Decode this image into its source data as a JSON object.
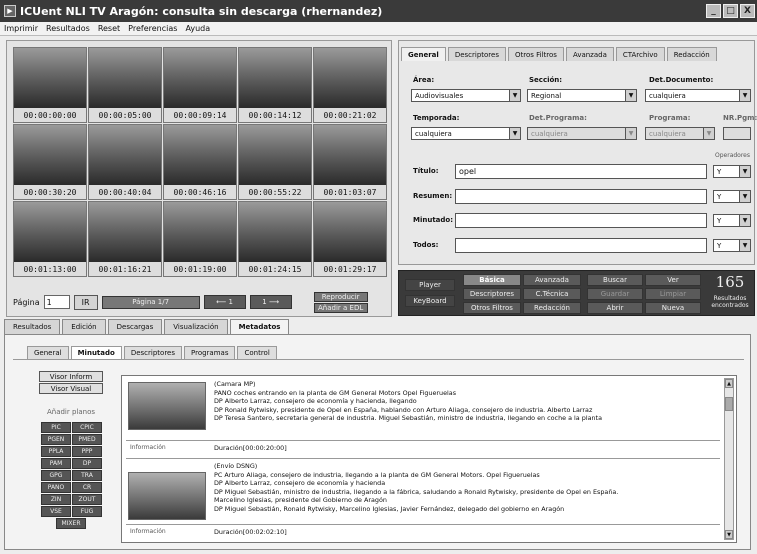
{
  "window": {
    "title": "ICUent NLI TV Aragón: consulta sin descarga (rhernandez)",
    "minimize": "_",
    "maximize": "□",
    "close": "X"
  },
  "menu": [
    "Imprimir",
    "Resultados",
    "Reset",
    "Preferencias",
    "Ayuda"
  ],
  "thumbnails": [
    "00:00:00:00",
    "00:00:05:00",
    "00:00:09:14",
    "00:00:14:12",
    "00:00:21:02",
    "00:00:30:20",
    "00:00:40:04",
    "00:00:46:16",
    "00:00:55:22",
    "00:01:03:07",
    "00:01:13:00",
    "00:01:16:21",
    "00:01:19:00",
    "00:01:24:15",
    "00:01:29:17"
  ],
  "pager": {
    "label": "Página",
    "value": "1",
    "go": "IR",
    "status": "Página 1/7",
    "prev": "⟵ 1",
    "next": "1 ⟶",
    "reproducir": "Reproducir",
    "anadir": "Añadir a EDL"
  },
  "search": {
    "tabs": [
      "General",
      "Descriptores",
      "Otros Filtros",
      "Avanzada",
      "CTArchivo",
      "Redacción"
    ],
    "area_label": "Área:",
    "area_value": "Audiovisuales",
    "seccion_label": "Sección:",
    "seccion_value": "Regional",
    "detdoc_label": "Det.Documento:",
    "detdoc_value": "cualquiera",
    "temporada_label": "Temporada:",
    "temporada_value": "cualquiera",
    "detprog_label": "Det.Programa:",
    "detprog_value": "cualquiera",
    "programa_label": "Programa:",
    "programa_value": "cualquiera",
    "nrpgm_label": "NR.Pgm:",
    "operadores_label": "Operadores",
    "titulo_label": "Título:",
    "titulo_value": "opel",
    "resumen_label": "Resumen:",
    "minutado_label": "Minutado:",
    "todos_label": "Todos:",
    "op": "Y"
  },
  "actions": {
    "player": "Player",
    "keyboard": "KeyBoard",
    "basica": "Básica",
    "avanzada": "Avanzada",
    "descriptores": "Descriptores",
    "ctecnica": "C.Técnica",
    "otrosfiltros": "Otros Filtros",
    "redaccion": "Redacción",
    "buscar": "Buscar",
    "ver": "Ver",
    "guardar": "Guardar",
    "limpiar": "Limpiar",
    "abrir": "Abrir",
    "nueva": "Nueva",
    "count": "165",
    "result_label": "Resultados encontrados"
  },
  "bottom_tabs": [
    "Resultados",
    "Edición",
    "Descargas",
    "Visualización",
    "Metadatos"
  ],
  "sub_tabs": [
    "General",
    "Minutado",
    "Descriptores",
    "Programas",
    "Control"
  ],
  "left": {
    "inform": "Visor Inform",
    "visual": "Visor Visual",
    "planos_label": "Añadir planos",
    "planos": [
      "PIC",
      "CPIC",
      "PGEN",
      "PMED",
      "PPLA",
      "PPP",
      "PAM",
      "DP",
      "GPG",
      "TRA",
      "PANO",
      "CR",
      "ZIN",
      "ZOUT",
      "VSE",
      "FUG"
    ],
    "mixer": "MIXER"
  },
  "entries": [
    {
      "lines": [
        "(Camara MP)",
        "PANO coches entrando en la planta de GM General Motors Opel Figueruelas",
        "DP Alberto Larraz, consejero de economía y hacienda, llegando",
        "DP Ronald Rytwisky, presidente de Opel en España, hablando con Arturo Aliaga, consejero de industria. Alberto Larraz",
        "DP Teresa Santero, secretaria general de industria. Miguel Sebastián, ministro de industria, llegando en coche a la planta"
      ],
      "link": "Información",
      "duration": "Duración[00:00:20:00]"
    },
    {
      "lines": [
        "(Envío DSNG)",
        "PC Arturo Aliaga, consejero de industria, llegando a la planta de GM General Motors. Opel Figueruelas",
        "DP Alberto Larraz, consejero de economía y hacienda",
        "DP Miguel Sebastián, ministro de industria, llegando a la fábrica, saludando a Ronald Rytwisky, presidente de Opel en España.",
        "Marcelino Iglesias, presidente del Gobierno de Aragón",
        "DP Miguel Sebastián, Ronald Rytwisky, Marcelino Iglesias, Javier Fernández, delegado del gobierno en Aragón"
      ],
      "link": "Información",
      "duration": "Duración[00:02:02:10]"
    }
  ]
}
